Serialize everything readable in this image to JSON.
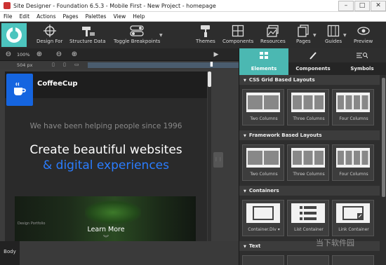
{
  "window": {
    "title": "Site Designer - Foundation 6.5.3 - Mobile First - New Project - homepage",
    "minimize": "–",
    "maximize": "□",
    "close": "✕"
  },
  "menu": [
    "File",
    "Edit",
    "Actions",
    "Pages",
    "Palettes",
    "View",
    "Help"
  ],
  "toolbar": {
    "design_for": "Design For",
    "structure_data": "Structure Data",
    "toggle_breakpoints": "Toggle Breakpoints",
    "themes": "Themes",
    "components": "Components",
    "resources": "Resources",
    "pages": "Pages",
    "guides": "Guides",
    "preview": "Preview"
  },
  "controls": {
    "zoom_level": "100%",
    "width_readout": "504 px"
  },
  "site": {
    "brand": "CoffeeCup",
    "tagline": "We have been helping people since 1996",
    "hero_line1": "Create beautiful websites",
    "hero_line2": "& digital experiences",
    "portfolio_caption": "Design Portfolio",
    "learn_more": "Learn More"
  },
  "body_tag": "Body",
  "panel": {
    "tabs": [
      "Elements",
      "Components",
      "Symbols"
    ],
    "active_tab": "Elements",
    "sections": [
      {
        "title": "CSS Grid Based Layouts",
        "items": [
          "Two Columns",
          "Three Columns",
          "Four Columns"
        ]
      },
      {
        "title": "Framework Based Layouts",
        "items": [
          "Two Columns",
          "Three Columns",
          "Four Columns"
        ]
      },
      {
        "title": "Containers",
        "items": [
          "Container.Div ▾",
          "List Container",
          "Link Container"
        ]
      },
      {
        "title": "Text",
        "items": []
      }
    ]
  },
  "watermark": "当下软件园",
  "colors": {
    "accent": "#4bb8b2",
    "brand_blue": "#1565e0",
    "hero_blue": "#2a7dff"
  }
}
